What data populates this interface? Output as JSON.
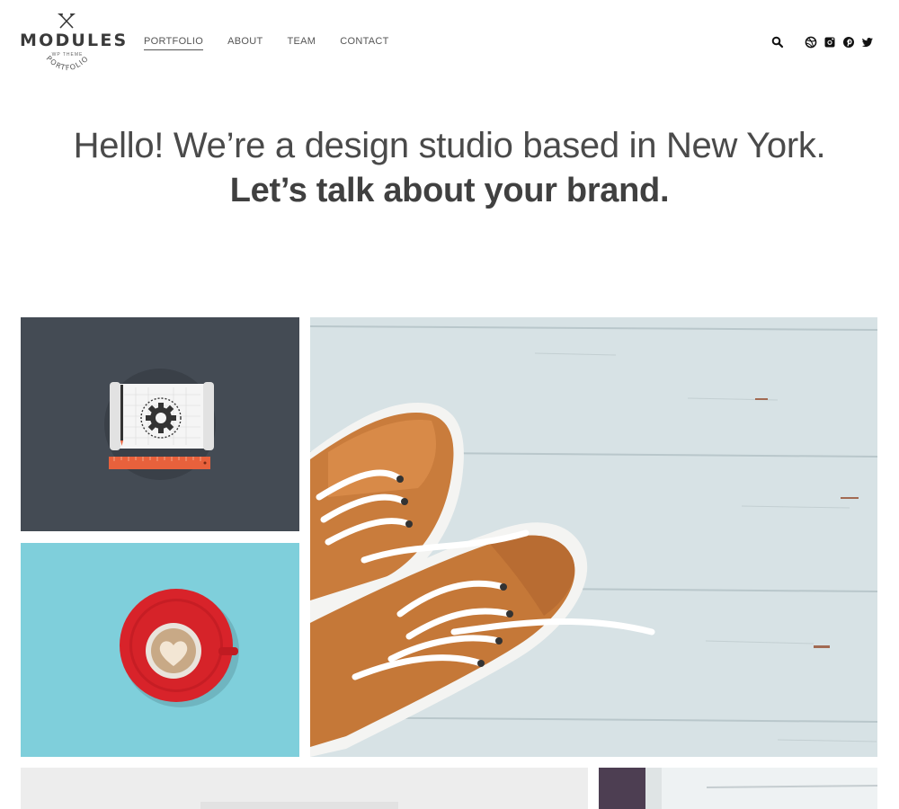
{
  "brand": {
    "name": "MODULES",
    "tagline": "WP THEME",
    "subtitle": "PORTFOLIO"
  },
  "nav": {
    "items": [
      {
        "label": "PORTFOLIO",
        "active": true
      },
      {
        "label": "ABOUT",
        "active": false
      },
      {
        "label": "TEAM",
        "active": false
      },
      {
        "label": "CONTACT",
        "active": false
      }
    ]
  },
  "header_icons": [
    "search-icon",
    "dribbble-icon",
    "instagram-icon",
    "pinterest-icon",
    "twitter-icon"
  ],
  "hero": {
    "line1": "Hello! We’re a design studio based in New York.",
    "line2": "Let’s talk about your brand."
  },
  "portfolio": {
    "tiles": [
      {
        "name": "blueprint-gear-illustration",
        "bg": "#444b54"
      },
      {
        "name": "coffee-cup-heart-photo",
        "bg": "#7fcfdb"
      },
      {
        "name": "orange-sneakers-photo",
        "bg": "#d5e0e3"
      },
      {
        "name": "bottom-left-tile",
        "bg": "#ececec"
      },
      {
        "name": "bottom-right-tile",
        "bg": "#e9eeef"
      }
    ]
  },
  "colors": {
    "text_dark": "#404040",
    "accent_orange": "#e8613c",
    "coffee_red": "#d8232a"
  }
}
